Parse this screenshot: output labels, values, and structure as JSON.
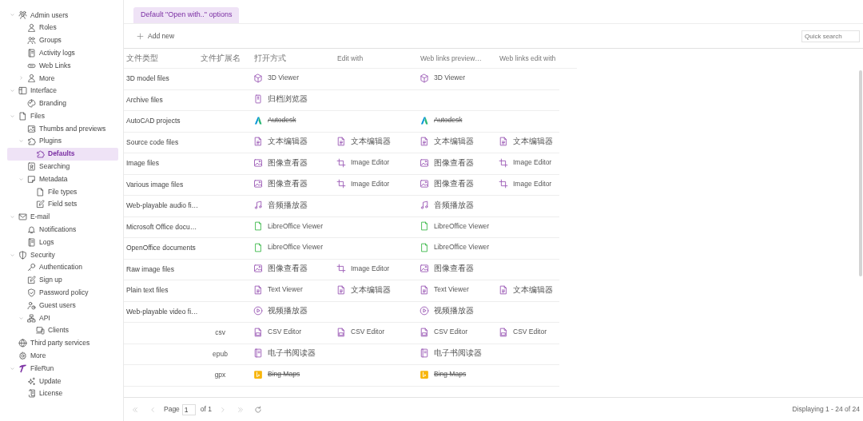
{
  "sidebar": {
    "items": [
      {
        "label": "Admin users",
        "expanded": true,
        "children": [
          {
            "label": "Roles"
          },
          {
            "label": "Groups"
          },
          {
            "label": "Activity logs"
          },
          {
            "label": "Web Links"
          },
          {
            "label": "More",
            "expanded": false
          }
        ]
      },
      {
        "label": "Interface",
        "expanded": true,
        "children": [
          {
            "label": "Branding"
          }
        ]
      },
      {
        "label": "Files",
        "expanded": true,
        "children": [
          {
            "label": "Thumbs and previews"
          },
          {
            "label": "Plugins",
            "expanded": true,
            "children": [
              {
                "label": "Defaults",
                "selected": true
              }
            ]
          },
          {
            "label": "Searching"
          },
          {
            "label": "Metadata",
            "expanded": true,
            "children": [
              {
                "label": "File types"
              },
              {
                "label": "Field sets"
              }
            ]
          }
        ]
      },
      {
        "label": "E-mail",
        "expanded": true,
        "children": [
          {
            "label": "Notifications"
          },
          {
            "label": "Logs"
          }
        ]
      },
      {
        "label": "Security",
        "expanded": true,
        "children": [
          {
            "label": "Authentication"
          },
          {
            "label": "Sign up"
          },
          {
            "label": "Password policy"
          },
          {
            "label": "Guest users"
          },
          {
            "label": "API",
            "expanded": true,
            "children": [
              {
                "label": "Clients"
              }
            ]
          }
        ]
      },
      {
        "label": "Third party services"
      },
      {
        "label": "More"
      },
      {
        "label": "FileRun",
        "expanded": true,
        "children": [
          {
            "label": "Update"
          },
          {
            "label": "License"
          }
        ]
      }
    ]
  },
  "tabs": [
    {
      "label": "Default \"Open with..\" options",
      "selected": true
    }
  ],
  "toolbar": {
    "add_button": "Add new",
    "search": {
      "placeholder": "Quick search"
    }
  },
  "table": {
    "columns": [
      "文件类型",
      "文件扩展名",
      "打开方式",
      "Edit with",
      "Web links preview…",
      "Web links edit with"
    ],
    "rows": [
      {
        "type": "3D model files",
        "cells": [
          {
            "kind": "cube",
            "label": "3D Viewer"
          },
          null,
          {
            "kind": "cube",
            "label": "3D Viewer"
          },
          null
        ]
      },
      {
        "type": "Archive files",
        "cells": [
          {
            "kind": "archive",
            "label": "归档浏览器"
          },
          null,
          null,
          null
        ]
      },
      {
        "type": "AutoCAD projects",
        "cells": [
          {
            "kind": "autodesk",
            "label": "Autodesk",
            "disabled": true
          },
          null,
          {
            "kind": "autodesk",
            "label": "Autodesk",
            "disabled": true
          },
          null
        ]
      },
      {
        "type": "Source code files",
        "cells": [
          {
            "kind": "doc",
            "label": "文本编辑器"
          },
          {
            "kind": "doc",
            "label": "文本编辑器"
          },
          {
            "kind": "doc",
            "label": "文本编辑器"
          },
          {
            "kind": "doc",
            "label": "文本编辑器"
          }
        ]
      },
      {
        "type": "Image files",
        "cells": [
          {
            "kind": "image",
            "label": "图像查看器"
          },
          {
            "kind": "crop",
            "label": "Image Editor"
          },
          {
            "kind": "image",
            "label": "图像查看器"
          },
          {
            "kind": "crop",
            "label": "Image Editor"
          }
        ]
      },
      {
        "type": "Various image files",
        "cells": [
          {
            "kind": "image",
            "label": "图像查看器"
          },
          {
            "kind": "crop",
            "label": "Image Editor"
          },
          {
            "kind": "image",
            "label": "图像查看器"
          },
          {
            "kind": "crop",
            "label": "Image Editor"
          }
        ]
      },
      {
        "type": "Web-playable audio fi…",
        "cells": [
          {
            "kind": "music",
            "label": "音频播放器"
          },
          null,
          {
            "kind": "music",
            "label": "音频播放器"
          },
          null
        ]
      },
      {
        "type": "Microsoft Office docu…",
        "cells": [
          {
            "kind": "office",
            "label": "LibreOffice Viewer"
          },
          null,
          {
            "kind": "office",
            "label": "LibreOffice Viewer"
          },
          null
        ]
      },
      {
        "type": "OpenOffice documents",
        "cells": [
          {
            "kind": "office",
            "label": "LibreOffice Viewer"
          },
          null,
          {
            "kind": "office",
            "label": "LibreOffice Viewer"
          },
          null
        ]
      },
      {
        "type": "Raw image files",
        "cells": [
          {
            "kind": "image",
            "label": "图像查看器"
          },
          {
            "kind": "crop",
            "label": "Image Editor"
          },
          {
            "kind": "image",
            "label": "图像查看器"
          },
          null
        ]
      },
      {
        "type": "Plain text files",
        "cells": [
          {
            "kind": "doc",
            "label": "Text Viewer"
          },
          {
            "kind": "doc",
            "label": "文本编辑器"
          },
          {
            "kind": "doc",
            "label": "Text Viewer"
          },
          {
            "kind": "doc",
            "label": "文本编辑器"
          }
        ]
      },
      {
        "type": "Web-playable video fi…",
        "cells": [
          {
            "kind": "play",
            "label": "视频播放器"
          },
          null,
          {
            "kind": "play",
            "label": "视频播放器"
          },
          null
        ]
      },
      {
        "extension": "csv",
        "cells": [
          {
            "kind": "csv",
            "label": "CSV Editor"
          },
          {
            "kind": "csv",
            "label": "CSV Editor"
          },
          {
            "kind": "csv",
            "label": "CSV Editor"
          },
          {
            "kind": "csv",
            "label": "CSV Editor"
          }
        ]
      },
      {
        "extension": "epub",
        "cells": [
          {
            "kind": "book",
            "label": "电子书阅读器"
          },
          null,
          {
            "kind": "book",
            "label": "电子书阅读器"
          },
          null
        ]
      },
      {
        "extension": "gpx",
        "cells": [
          {
            "kind": "bing",
            "label": "Bing Maps",
            "disabled": true
          },
          null,
          {
            "kind": "bing",
            "label": "Bing Maps",
            "disabled": true
          },
          null
        ]
      }
    ]
  },
  "pager": {
    "label": "Page",
    "page": "1",
    "of": "of 1",
    "buttons": [
      {
        "kind": "first"
      },
      {
        "kind": "prev"
      },
      {
        "kind": "next"
      },
      {
        "kind": "last"
      },
      {
        "kind": "refresh"
      }
    ]
  },
  "status": "Displaying 1 - 24 of 24"
}
